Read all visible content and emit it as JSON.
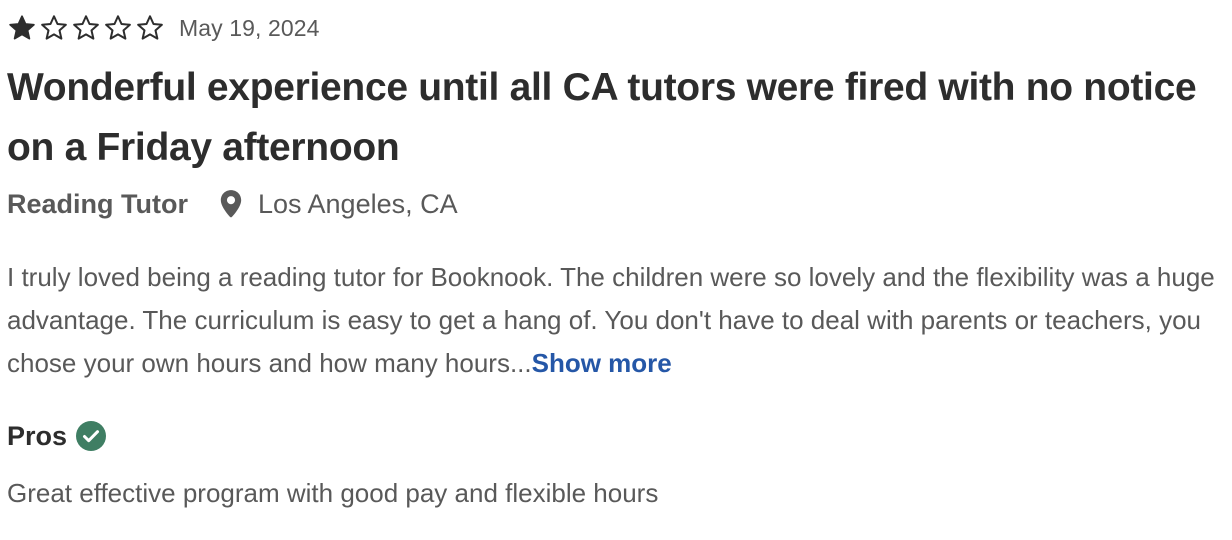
{
  "review": {
    "rating": 1,
    "rating_max": 5,
    "date": "May 19, 2024",
    "title": "Wonderful experience until all CA tutors were fired with no notice on a Friday afternoon",
    "job_title": "Reading Tutor",
    "location": "Los Angeles, CA",
    "body": "I truly loved being a reading tutor for Booknook. The children were so lovely and the flexibility was a huge advantage. The curriculum is easy to get a hang of. You don't have to deal with parents or teachers, you chose your own hours and how many hours...",
    "show_more_label": "Show more",
    "pros_label": "Pros",
    "pros_text": "Great effective program with good pay and flexible hours"
  },
  "icons": {
    "star_filled": "star-filled-icon",
    "star_empty": "star-outline-icon",
    "location": "location-pin-icon",
    "pros_check": "check-circle-icon"
  },
  "colors": {
    "text_primary": "#2d2d2d",
    "text_secondary": "#595959",
    "link": "#2557a7",
    "pros_check": "#3f7e63"
  }
}
